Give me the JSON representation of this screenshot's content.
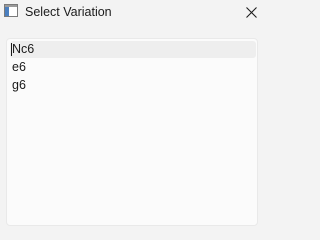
{
  "window": {
    "title": "Select Variation",
    "app_icon": "window-app-icon",
    "close_icon": "close-icon"
  },
  "variations": {
    "items": [
      {
        "label": "Nc6",
        "selected": true
      },
      {
        "label": "e6",
        "selected": false
      },
      {
        "label": "g6",
        "selected": false
      }
    ]
  },
  "colors": {
    "window_background": "#f3f3f3",
    "list_background": "#fbfbfb",
    "selected_background": "#eeeeee",
    "text": "#1b1b1b"
  }
}
